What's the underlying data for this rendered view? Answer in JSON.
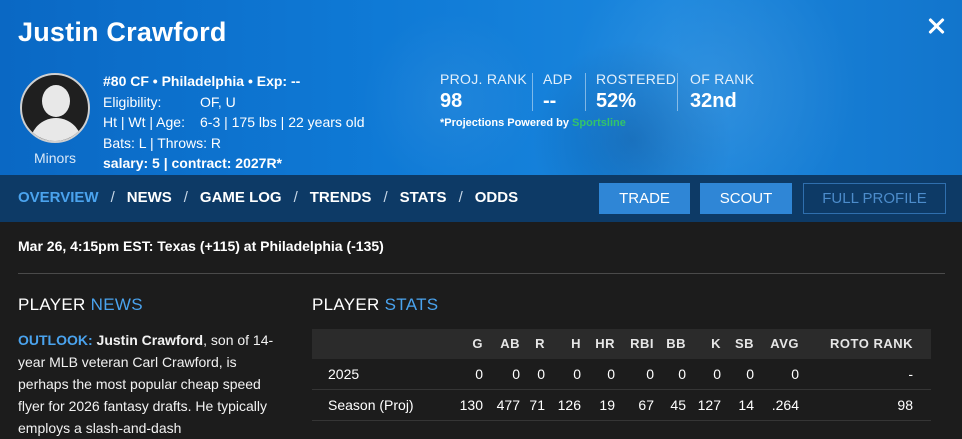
{
  "player": {
    "name": "Justin Crawford",
    "info_line": "#80 CF • Philadelphia • Exp: --",
    "eligibility_label": "Eligibility:",
    "eligibility_value": "OF, U",
    "measure_label": "Ht | Wt | Age:",
    "measure_value": "6-3 | 175 lbs | 22 years old",
    "bats_throws": "Bats: L | Throws: R",
    "salary_contract": "salary: 5 | contract: 2027R*",
    "level": "Minors"
  },
  "header_stats": {
    "proj_rank_label": "PROJ. RANK",
    "proj_rank_value": "98",
    "adp_label": "ADP",
    "adp_value": "--",
    "rostered_label": "ROSTERED",
    "rostered_value": "52%",
    "of_rank_label": "OF RANK",
    "of_rank_value": "32nd",
    "powered_prefix": "*Projections Powered by ",
    "powered_brand": "Sportsline"
  },
  "nav": {
    "tabs": [
      "OVERVIEW",
      "NEWS",
      "GAME LOG",
      "TRENDS",
      "STATS",
      "ODDS"
    ],
    "sep": "/",
    "trade_label": "TRADE",
    "scout_label": "SCOUT",
    "full_profile_label": "FULL PROFILE"
  },
  "game": {
    "line": "Mar 26, 4:15pm EST: Texas (+115) at Philadelphia (-135)"
  },
  "news_section": {
    "title_a": "PLAYER ",
    "title_b": "NEWS",
    "outlook_label": "OUTLOOK:",
    "name": "Justin Crawford",
    "text": ", son of 14-year MLB veteran Carl Crawford, is perhaps the most popular cheap speed flyer for 2026 fantasy drafts. He typically employs a slash-and-dash"
  },
  "stats_section": {
    "title_a": "PLAYER ",
    "title_b": "STATS",
    "columns": [
      "G",
      "AB",
      "R",
      "H",
      "HR",
      "RBI",
      "BB",
      "K",
      "SB",
      "AVG",
      "ROTO RANK"
    ],
    "rows": [
      {
        "label": "2025",
        "values": [
          "0",
          "0",
          "0",
          "0",
          "0",
          "0",
          "0",
          "0",
          "0",
          "0",
          "-"
        ]
      },
      {
        "label": "Season (Proj)",
        "values": [
          "130",
          "477",
          "71",
          "126",
          "19",
          "67",
          "45",
          "127",
          "14",
          ".264",
          "98"
        ]
      }
    ]
  },
  "colors": {
    "accent": "#4aa3ee",
    "header_blue": "#0f7ad6",
    "nav_bg": "#0d3a66",
    "button_blue": "#2f86d6",
    "brand_green": "#33c46a"
  }
}
